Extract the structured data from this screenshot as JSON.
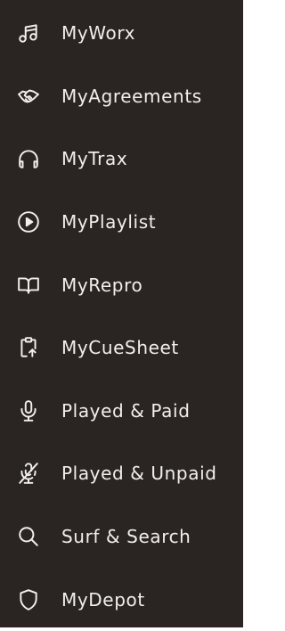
{
  "sidebar": {
    "items": [
      {
        "label": "MyWorx",
        "icon": "music-note-icon"
      },
      {
        "label": "MyAgreements",
        "icon": "handshake-icon"
      },
      {
        "label": "MyTrax",
        "icon": "headphones-icon"
      },
      {
        "label": "MyPlaylist",
        "icon": "play-circle-icon"
      },
      {
        "label": "MyRepro",
        "icon": "book-open-icon"
      },
      {
        "label": "MyCueSheet",
        "icon": "clipboard-upload-icon"
      },
      {
        "label": "Played & Paid",
        "icon": "microphone-icon"
      },
      {
        "label": "Played & Unpaid",
        "icon": "microphone-off-icon"
      },
      {
        "label": "Surf & Search",
        "icon": "search-icon"
      },
      {
        "label": "MyDepot",
        "icon": "shield-icon"
      }
    ],
    "colors": {
      "background": "#2a2522",
      "text": "#f2efeb"
    }
  }
}
